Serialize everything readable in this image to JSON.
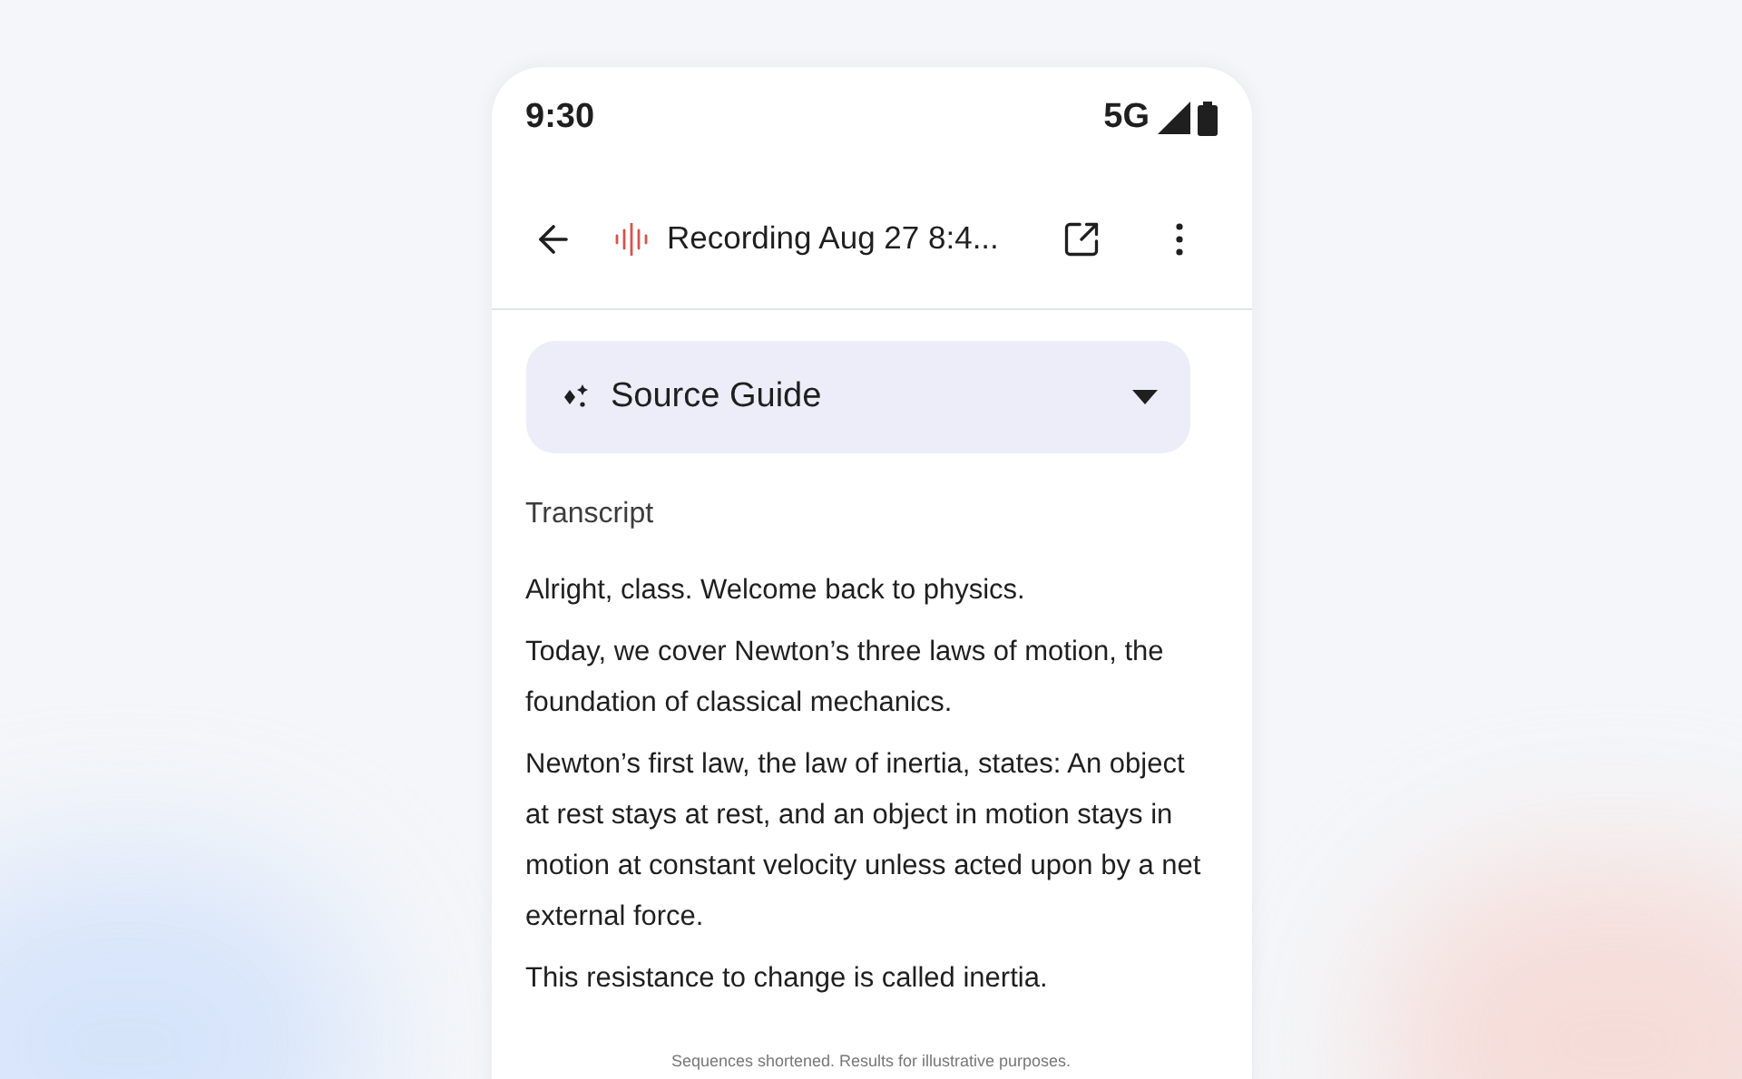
{
  "status_bar": {
    "time": "9:30",
    "network": "5G"
  },
  "header": {
    "title": "Recording Aug 27 8:4..."
  },
  "source_guide": {
    "label": "Source Guide",
    "expanded": false
  },
  "section_label": "Transcript",
  "paragraphs": [
    "Alright, class. Welcome back to physics.",
    "Today, we cover Newton’s three laws of motion, the foundation of classical mechanics.",
    "Newton’s first law, the law of inertia, states: An object at rest stays at rest, and an object in motion stays in motion at constant velocity unless acted upon by a net external force.",
    "This resistance to change is called inertia."
  ],
  "disclaimer": "Sequences shortened. Results for illustrative purposes."
}
